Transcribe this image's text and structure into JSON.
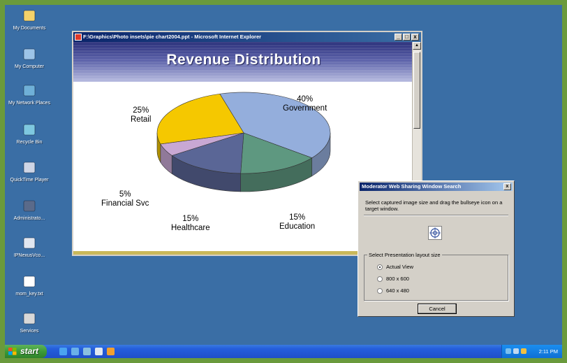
{
  "desktop_icons": [
    {
      "label": "My Documents",
      "icon": "folder-icon"
    },
    {
      "label": "My Computer",
      "icon": "computer-icon"
    },
    {
      "label": "My Network Places",
      "icon": "network-icon"
    },
    {
      "label": "Recycle Bin",
      "icon": "recycle-bin-icon"
    },
    {
      "label": "QuickTime Player",
      "icon": "quicktime-icon"
    },
    {
      "label": "Administrato...",
      "icon": "user-icon"
    },
    {
      "label": "IPNexusVco...",
      "icon": "phone-icon"
    },
    {
      "label": "mom_key.txt",
      "icon": "text-file-icon"
    },
    {
      "label": "Services",
      "icon": "services-icon"
    }
  ],
  "ie_window": {
    "title": "F:\\Graphics\\Photo insets\\pie chart2004.ppt - Microsoft Internet Explorer",
    "buttons": [
      "_",
      "□",
      "x"
    ]
  },
  "slide": {
    "title": "Revenue Distribution"
  },
  "chart_data": {
    "type": "pie",
    "title": "Revenue Distribution",
    "slices": [
      {
        "label": "Government",
        "value": 40,
        "display": "40%",
        "color": "#94aedc"
      },
      {
        "label": "Education",
        "value": 15,
        "display": "15%",
        "color": "#5e9880"
      },
      {
        "label": "Healthcare",
        "value": 15,
        "display": "15%",
        "color": "#5a6696"
      },
      {
        "label": "Financial Svc",
        "value": 5,
        "display": "5%",
        "color": "#c8a8d4"
      },
      {
        "label": "Retail",
        "value": 25,
        "display": "25%",
        "color": "#f5c800"
      }
    ]
  },
  "dialog": {
    "title": "Moderator Web Sharing Window Search",
    "close": "x",
    "instructions": "Select captured image size and drag the bullseye icon on a target window.",
    "group_label": "Select Presentation layout size",
    "options": [
      {
        "label": "Actual View",
        "selected": true
      },
      {
        "label": "800 x 600",
        "selected": false
      },
      {
        "label": "640 x 480",
        "selected": false
      }
    ],
    "cancel_label": "Cancel"
  },
  "taskbar": {
    "start_label": "start",
    "clock": "2:11 PM"
  },
  "colors": {
    "desktop": "#3a6ea5",
    "frame": "#6a9a3c",
    "taskbar": "#245edc",
    "start": "#3c9a37"
  }
}
